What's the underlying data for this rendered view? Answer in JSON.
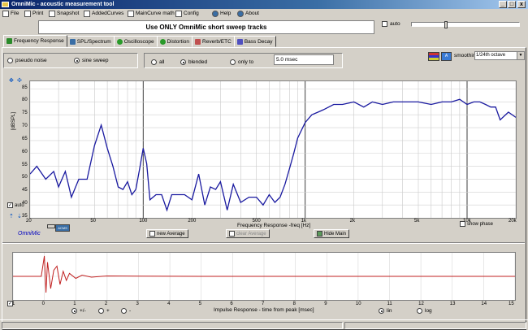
{
  "window": {
    "title": "OmniMic - acoustic measurement tool",
    "min": "_",
    "max": "□",
    "close": "x"
  },
  "menu": [
    "File",
    "Print",
    "Snapshot",
    "AddedCurves",
    "MainCurve math",
    "Config",
    "Help",
    "About"
  ],
  "banner": "Use ONLY OmniMic short sweep tracks",
  "top_auto": "auto",
  "tabs": [
    "Frequency Response",
    "SPL/Spectrum",
    "Oscilloscope",
    "Distortion",
    "Reverb/ETC",
    "Bass Decay"
  ],
  "signal": {
    "pseudo_noise": "pseudo noise",
    "sine_sweep": "sine sweep"
  },
  "window_opts": {
    "all": "all",
    "blended": "blended",
    "only_to": "only to",
    "msec_value": "5.0 msec"
  },
  "smoothing": {
    "label": "smoothing",
    "value": "1/24th octave",
    "flag_btn": "A"
  },
  "fr": {
    "y_ticks": [
      "85",
      "80",
      "75",
      "70",
      "65",
      "60",
      "55",
      "50",
      "45",
      "40",
      "35"
    ],
    "ylabel": "[dBSPL]",
    "auto": "auto",
    "x_ticks": [
      "20",
      "50",
      "100",
      "200",
      "500",
      "1k",
      "2k",
      "5k",
      "10k",
      "20k"
    ],
    "xlabel": "Frequency Response  -freq [Hz]",
    "show_phase": "show phase",
    "new_average": "new Average",
    "clear_average": "clear Average",
    "hide_main": "Hide Main",
    "brand": "OmniMic",
    "badge": "ACMS"
  },
  "chart_data": [
    {
      "type": "line",
      "xlabel": "Frequency Response  -freq [Hz]",
      "ylabel": "[dBSPL]",
      "xscale": "log",
      "xlim": [
        20,
        20000
      ],
      "ylim": [
        35,
        88
      ],
      "series": [
        {
          "color": "#1a1aa0",
          "x": [
            20,
            22,
            25,
            28,
            30,
            33,
            36,
            40,
            45,
            50,
            55,
            60,
            65,
            70,
            75,
            80,
            85,
            90,
            95,
            100,
            105,
            110,
            120,
            130,
            140,
            150,
            160,
            180,
            200,
            220,
            240,
            260,
            280,
            300,
            330,
            360,
            400,
            450,
            500,
            550,
            600,
            650,
            700,
            750,
            800,
            850,
            900,
            1000,
            1100,
            1200,
            1300,
            1500,
            1700,
            2000,
            2300,
            2600,
            3000,
            3500,
            4000,
            5000,
            6000,
            7000,
            8000,
            9000,
            10000,
            11000,
            12000,
            13000,
            14000,
            15000,
            16000,
            18000,
            20000
          ],
          "y": [
            52,
            55,
            50,
            53,
            47,
            53,
            43,
            50,
            50,
            63,
            71,
            62,
            55,
            47,
            46,
            49,
            44,
            46,
            54,
            62,
            56,
            42,
            44,
            44,
            38,
            44,
            44,
            44,
            42,
            52,
            40,
            47,
            46,
            49,
            38,
            48,
            41,
            43,
            43,
            40,
            44,
            41,
            43,
            48,
            54,
            60,
            66,
            72,
            75,
            76,
            77,
            79,
            79,
            80,
            78,
            80,
            79,
            80,
            80,
            80,
            79,
            80,
            80,
            81,
            79,
            80,
            80,
            79,
            78,
            78,
            73,
            76,
            74
          ]
        }
      ]
    },
    {
      "type": "line",
      "xlabel": "Impulse Response  - time from peak [msec]",
      "xlim": [
        -1,
        15
      ],
      "series": [
        {
          "color": "#c02020",
          "x": [
            -1,
            -0.1,
            0,
            0.05,
            0.1,
            0.2,
            0.3,
            0.4,
            0.5,
            0.6,
            0.7,
            0.8,
            1.0,
            1.2,
            1.5,
            2,
            3,
            5,
            8,
            12,
            15
          ],
          "y": [
            0,
            0,
            1,
            -0.8,
            0.7,
            -0.6,
            0.3,
            0.5,
            -0.4,
            0.25,
            -0.2,
            0.15,
            -0.1,
            0.06,
            -0.04,
            0.02,
            0.01,
            0,
            0,
            0,
            0
          ]
        }
      ]
    }
  ],
  "ir": {
    "x_ticks": [
      "-1",
      "0",
      "1",
      "2",
      "3",
      "4",
      "5",
      "6",
      "7",
      "8",
      "9",
      "10",
      "11",
      "12",
      "13",
      "14",
      "15"
    ],
    "xlabel": "Impulse Response  - time from peak [msec]",
    "pol_pm": "+/-",
    "pol_plus": "+",
    "pol_minus": "-",
    "lin": "lin",
    "log": "log"
  }
}
